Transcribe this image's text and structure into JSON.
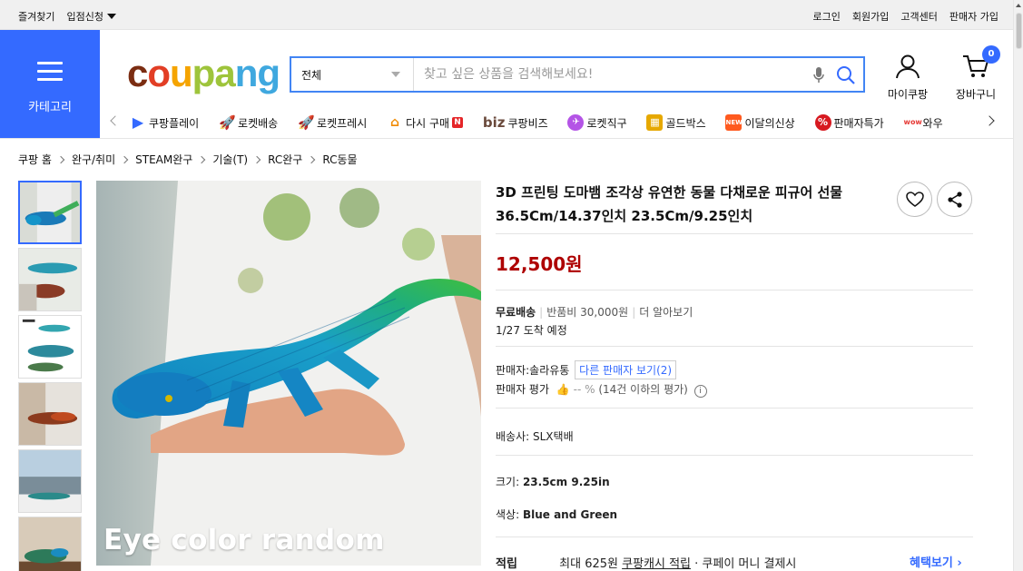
{
  "topbar": {
    "left": [
      "즐겨찾기",
      "입점신청"
    ],
    "right": [
      "로그인",
      "회원가입",
      "고객센터",
      "판매자 가입"
    ]
  },
  "category_block": {
    "label": "카테고리"
  },
  "logo": {
    "parts": [
      "c",
      "o",
      "u",
      "pa",
      "ng"
    ],
    "colors": [
      "#7b2d12",
      "#e23e25",
      "#f5a400",
      "#9ec43b",
      "#3fa8df"
    ]
  },
  "search": {
    "category": "전체",
    "placeholder": "찾고 싶은 상품을 검색해보세요!"
  },
  "header": {
    "mypage": "마이쿠팡",
    "cart": "장바구니",
    "cart_count": "0"
  },
  "quicknav": [
    {
      "label": "쿠팡플레이",
      "icon": "play-icon"
    },
    {
      "label": "로켓배송",
      "icon": "rocket-icon"
    },
    {
      "label": "로켓프레시",
      "icon": "rocket-fresh-icon"
    },
    {
      "label": "다시 구매",
      "icon": "rebuy-icon"
    },
    {
      "label": "쿠팡비즈",
      "icon": "biz-icon",
      "prefix": "biz"
    },
    {
      "label": "로켓직구",
      "icon": "global-rocket-icon"
    },
    {
      "label": "골드박스",
      "icon": "gold-box-icon"
    },
    {
      "label": "이달의신상",
      "icon": "new-arrival-icon"
    },
    {
      "label": "판매자특가",
      "icon": "seller-deal-icon"
    },
    {
      "label": "와우",
      "icon": "wow-icon"
    }
  ],
  "breadcrumb": [
    "쿠팡 홈",
    "완구/취미",
    "STEAM완구",
    "기술(T)",
    "RC완구",
    "RC동물"
  ],
  "product": {
    "title": "3D 프린팅 도마뱀 조각상 유연한 동물 다채로운 피규어 선물 36.5Cm/14.37인치 23.5Cm/9.25인치",
    "price": "12,500원",
    "shipping_label": "무료배송",
    "return_fee": "반품비 30,000원",
    "more_info": "더 알아보기",
    "arrival": "1/27 도착 예정",
    "seller": "판매자:솔라유통",
    "other_sellers": "다른 판매자 보기(2)",
    "seller_rating_label": "판매자 평가",
    "seller_rating_value": "-- %",
    "seller_rating_note": "(14건 이하의 평가)",
    "courier_label": "배송사:",
    "courier": "SLX택배",
    "size_label": "크기:",
    "size_value": "23.5cm 9.25in",
    "color_label": "색상:",
    "color_value": "Blue and Green",
    "reward_label": "적립",
    "reward_text": "최대 625원",
    "reward_link": "쿠팡캐시 적립",
    "reward_tail": "· 쿠페이 머니 결제시",
    "benefit_link": "혜택보기"
  },
  "main_image": {
    "caption": "Eye color random"
  },
  "colors": {
    "accent": "#346aff",
    "price": "#ae0000"
  }
}
